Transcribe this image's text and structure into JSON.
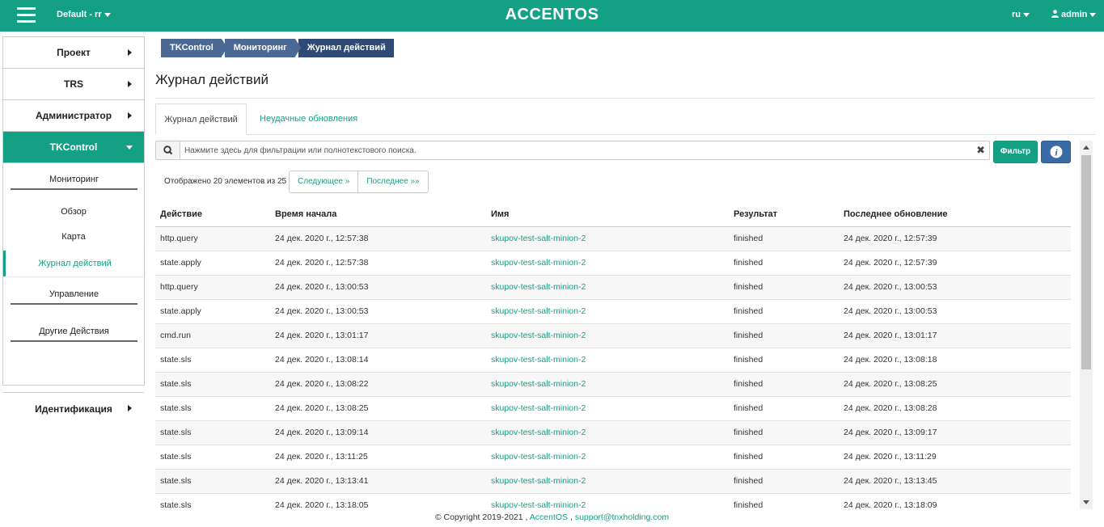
{
  "topbar": {
    "project": "Default - rr",
    "logo": "ACCENTOS",
    "lang": "ru",
    "user": "admin"
  },
  "sidebar": {
    "items": [
      {
        "label": "Проект"
      },
      {
        "label": "TRS"
      },
      {
        "label": "Администратор"
      },
      {
        "label": "TKControl"
      },
      {
        "label": "Идентификация"
      }
    ],
    "sub": {
      "monitoring": "Мониторинг",
      "overview": "Обзор",
      "map": "Карта",
      "journal": "Журнал действий",
      "management": "Управление",
      "other": "Другие Действия"
    }
  },
  "breadcrumb": [
    "TKControl",
    "Мониторинг",
    "Журнал действий"
  ],
  "page_title": "Журнал действий",
  "tabs": [
    "Журнал действий",
    "Неудачные обновления"
  ],
  "search": {
    "placeholder": "Нажмите здесь для фильтрации или полнотекстового поиска."
  },
  "filter_label": "Фильтр",
  "count_text": "Отображено 20 элементов из 25",
  "pager": {
    "next": "Следующее »",
    "last": "Последнее »»"
  },
  "table": {
    "headers": [
      "Действие",
      "Время начала",
      "Имя",
      "Результат",
      "Последнее обновление"
    ],
    "rows": [
      [
        "http.query",
        "24 дек. 2020 г., 12:57:38",
        "skupov-test-salt-minion-2",
        "finished",
        "24 дек. 2020 г., 12:57:39"
      ],
      [
        "state.apply",
        "24 дек. 2020 г., 12:57:38",
        "skupov-test-salt-minion-2",
        "finished",
        "24 дек. 2020 г., 12:57:39"
      ],
      [
        "http.query",
        "24 дек. 2020 г., 13:00:53",
        "skupov-test-salt-minion-2",
        "finished",
        "24 дек. 2020 г., 13:00:53"
      ],
      [
        "state.apply",
        "24 дек. 2020 г., 13:00:53",
        "skupov-test-salt-minion-2",
        "finished",
        "24 дек. 2020 г., 13:00:53"
      ],
      [
        "cmd.run",
        "24 дек. 2020 г., 13:01:17",
        "skupov-test-salt-minion-2",
        "finished",
        "24 дек. 2020 г., 13:01:17"
      ],
      [
        "state.sls",
        "24 дек. 2020 г., 13:08:14",
        "skupov-test-salt-minion-2",
        "finished",
        "24 дек. 2020 г., 13:08:18"
      ],
      [
        "state.sls",
        "24 дек. 2020 г., 13:08:22",
        "skupov-test-salt-minion-2",
        "finished",
        "24 дек. 2020 г., 13:08:25"
      ],
      [
        "state.sls",
        "24 дек. 2020 г., 13:08:25",
        "skupov-test-salt-minion-2",
        "finished",
        "24 дек. 2020 г., 13:08:28"
      ],
      [
        "state.sls",
        "24 дек. 2020 г., 13:09:14",
        "skupov-test-salt-minion-2",
        "finished",
        "24 дек. 2020 г., 13:09:17"
      ],
      [
        "state.sls",
        "24 дек. 2020 г., 13:11:25",
        "skupov-test-salt-minion-2",
        "finished",
        "24 дек. 2020 г., 13:11:29"
      ],
      [
        "state.sls",
        "24 дек. 2020 г., 13:13:41",
        "skupov-test-salt-minion-2",
        "finished",
        "24 дек. 2020 г., 13:13:45"
      ],
      [
        "state.sls",
        "24 дек. 2020 г., 13:18:05",
        "skupov-test-salt-minion-2",
        "finished",
        "24 дек. 2020 г., 13:18:09"
      ]
    ]
  },
  "footer": {
    "copyright": "© Copyright 2019-2021 ,",
    "accentos": "AccentOS",
    "sep": ",",
    "email": "support@tnxholding.com"
  },
  "colors": {
    "accent": "#14a085",
    "breadcrumb": "#4a6a95",
    "breadcrumb_active": "#2f4a75",
    "info": "#3b6aa8"
  },
  "icons": [
    "menu-icon",
    "user-icon",
    "search-icon",
    "close-icon",
    "info-icon",
    "chevron-right-icon",
    "chevron-down-icon"
  ]
}
